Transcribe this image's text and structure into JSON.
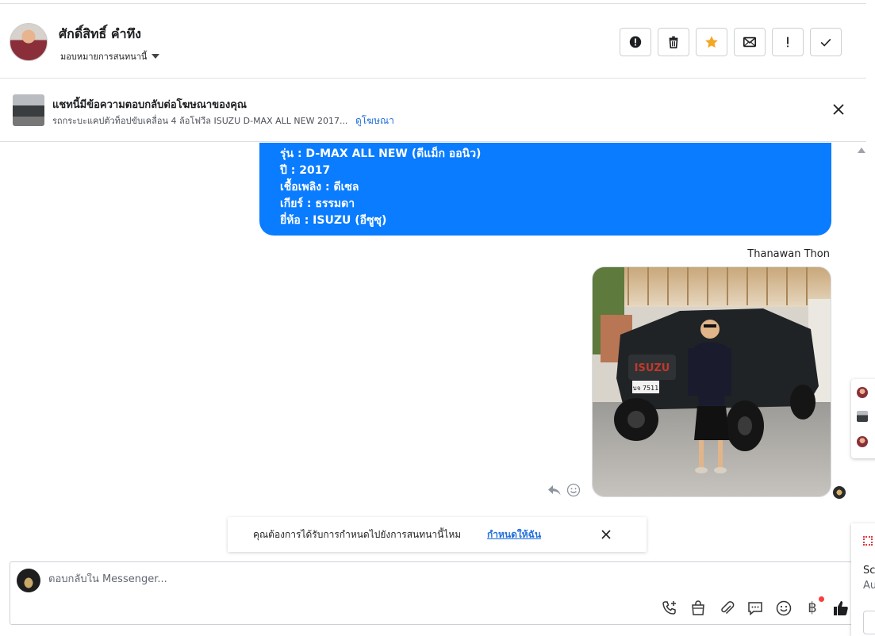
{
  "header": {
    "contact_name": "ศักดิ์สิทธิ์ คำทึง",
    "assign_label": "มอบหมายการสนทนานี้"
  },
  "ad_banner": {
    "title": "แชทนี้มีข้อความตอบกลับต่อโฆษณาของคุณ",
    "subtitle": "รถกระบะแคปตัวท็อปขับเคลื่อน 4 ล้อโฟวีล ISUZU D-MAX ALL NEW 2017...",
    "link": "ดูโฆษณา"
  },
  "messages": {
    "bubble_lines": [
      "รุ่น : D-MAX ALL NEW (ดีแม็ก ออนิว)",
      "ปี : 2017",
      "เชื้อเพลิง : ดีเซล",
      "เกียร์ : ธรรมดา",
      "ยี่ห้อ : ISUZU (อีซูซุ)"
    ],
    "sender_name": "Thanawan Thon",
    "photo_plate": "บจ 7511",
    "photo_brand": "ISUZU"
  },
  "assign_toast": {
    "text": "คุณต้องการได้รับการกำหนดไปยังการสนทนานี้ไหม",
    "link": "กำหนดให้ฉัน"
  },
  "composer": {
    "placeholder": "ตอบกลับใน Messenger..."
  },
  "side_panel": {
    "line1": "Sc",
    "line2": "Au"
  },
  "colors": {
    "accent": "#0a7cff",
    "link": "#216fdb",
    "star": "#f5a623"
  }
}
